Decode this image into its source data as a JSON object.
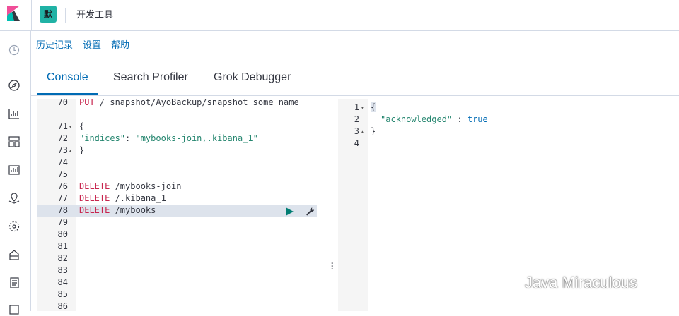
{
  "header": {
    "space_initial": "默",
    "title": "开发工具"
  },
  "submenu": {
    "history": "历史记录",
    "settings": "设置",
    "help": "帮助"
  },
  "tabs": [
    {
      "label": "Console",
      "active": true
    },
    {
      "label": "Search Profiler",
      "active": false
    },
    {
      "label": "Grok Debugger",
      "active": false
    }
  ],
  "editor": {
    "lines": [
      {
        "num": "70",
        "method": "PUT",
        "rest": " /_snapshot/AyoBackup/snapshot_some_name"
      },
      {
        "num": "",
        "method": "",
        "rest": ""
      },
      {
        "num": "71",
        "text": "{"
      },
      {
        "num": "72",
        "key": "\"indices\"",
        "sep": ": ",
        "value": "\"mybooks-join,.kibana_1\""
      },
      {
        "num": "73",
        "text": "}"
      },
      {
        "num": "74",
        "text": ""
      },
      {
        "num": "75",
        "text": ""
      },
      {
        "num": "76",
        "method": "DELETE",
        "rest": " /mybooks-join"
      },
      {
        "num": "77",
        "method": "DELETE",
        "rest": " /.kibana_1"
      },
      {
        "num": "78",
        "method": "DELETE",
        "rest": " /mybooks"
      },
      {
        "num": "79",
        "text": ""
      },
      {
        "num": "80",
        "text": ""
      },
      {
        "num": "81",
        "text": ""
      },
      {
        "num": "82",
        "text": ""
      },
      {
        "num": "83",
        "text": ""
      },
      {
        "num": "84",
        "text": ""
      },
      {
        "num": "85",
        "text": ""
      },
      {
        "num": "86",
        "text": ""
      }
    ]
  },
  "response": {
    "lines": [
      {
        "num": "1",
        "text": "{"
      },
      {
        "num": "2",
        "key": "\"acknowledged\"",
        "sep": " : ",
        "value": "true"
      },
      {
        "num": "3",
        "text": "}"
      },
      {
        "num": "4",
        "text": ""
      }
    ]
  },
  "watermark": "Java Miraculous",
  "colors": {
    "accent": "#006bb4",
    "method": "#c7254e",
    "string": "#25866f",
    "run": "#017d73"
  }
}
